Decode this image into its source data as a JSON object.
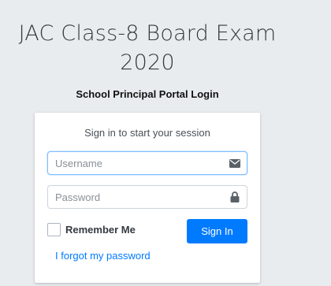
{
  "header": {
    "title_line1": "JAC Class-8 Board Exam",
    "title_line2": "2020",
    "subtitle": "School Principal Portal Login"
  },
  "login": {
    "message": "Sign in to start your session",
    "username": {
      "value": "",
      "placeholder": "Username",
      "icon": "envelope-icon"
    },
    "password": {
      "value": "",
      "placeholder": "Password",
      "icon": "lock-icon"
    },
    "remember_label": "Remember Me",
    "remember_checked": false,
    "signin_label": "Sign In",
    "forgot_label": "I forgot my password"
  },
  "colors": {
    "background": "#e9ecef",
    "primary": "#007bff",
    "focus_border": "#80bdff"
  }
}
